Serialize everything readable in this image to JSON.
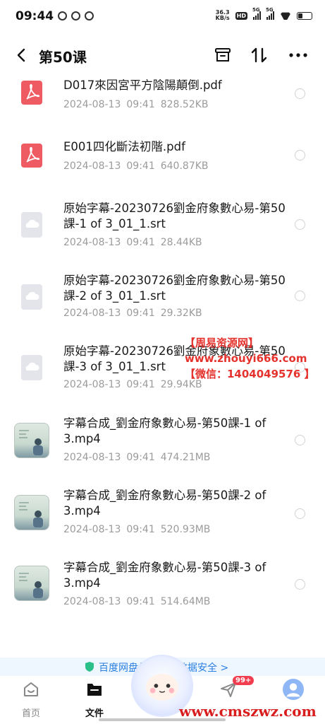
{
  "status_bar": {
    "time": "09:44",
    "net_speed_value": "36.3",
    "net_speed_unit": "KB/s",
    "hd_label": "HD",
    "sim1_label": "5G",
    "sim2_label": "5G"
  },
  "header": {
    "title": "第50课"
  },
  "files": [
    {
      "name": "D017來因宮平方陰陽顛倒.pdf",
      "date": "2024-08-13",
      "time": "09:41",
      "size": "828.52KB",
      "type": "pdf"
    },
    {
      "name": "E001四化斷法初階.pdf",
      "date": "2024-08-13",
      "time": "09:41",
      "size": "640.87KB",
      "type": "pdf"
    },
    {
      "name": "原始字幕-20230726劉金府象數心易-第50課-1 of 3_01_1.srt",
      "date": "2024-08-13",
      "time": "09:41",
      "size": "28.44KB",
      "type": "srt"
    },
    {
      "name": "原始字幕-20230726劉金府象數心易-第50課-2 of 3_01_1.srt",
      "date": "2024-08-13",
      "time": "09:41",
      "size": "29.32KB",
      "type": "srt"
    },
    {
      "name": "原始字幕-20230726劉金府象數心易-第50課-3 of 3_01_1.srt",
      "date": "2024-08-13",
      "time": "09:41",
      "size": "29.94KB",
      "type": "srt"
    },
    {
      "name": "字幕合成_劉金府象數心易-第50課-1 of 3.mp4",
      "date": "2024-08-13",
      "time": "09:41",
      "size": "474.21MB",
      "type": "mp4"
    },
    {
      "name": "字幕合成_劉金府象數心易-第50課-2 of 3.mp4",
      "date": "2024-08-13",
      "time": "09:41",
      "size": "520.93MB",
      "type": "mp4"
    },
    {
      "name": "字幕合成_劉金府象數心易-第50課-3 of 3.mp4",
      "date": "2024-08-13",
      "time": "09:41",
      "size": "514.64MB",
      "type": "mp4"
    }
  ],
  "watermark": {
    "line1": "【周易资源网】",
    "line2": "www.zhouyi666.com",
    "line3": "【微信：1404049576 】"
  },
  "security_banner": {
    "text": "百度网盘保护你的数据安全 >"
  },
  "bottom_nav": {
    "home_label": "首页",
    "files_label": "文件",
    "share_badge": "99+"
  },
  "site_mark": "www.cmszwz.com",
  "colors": {
    "pdf_red": "#ef5b62",
    "accent_blue": "#2a7fe0",
    "badge_red": "#f23d4f"
  }
}
